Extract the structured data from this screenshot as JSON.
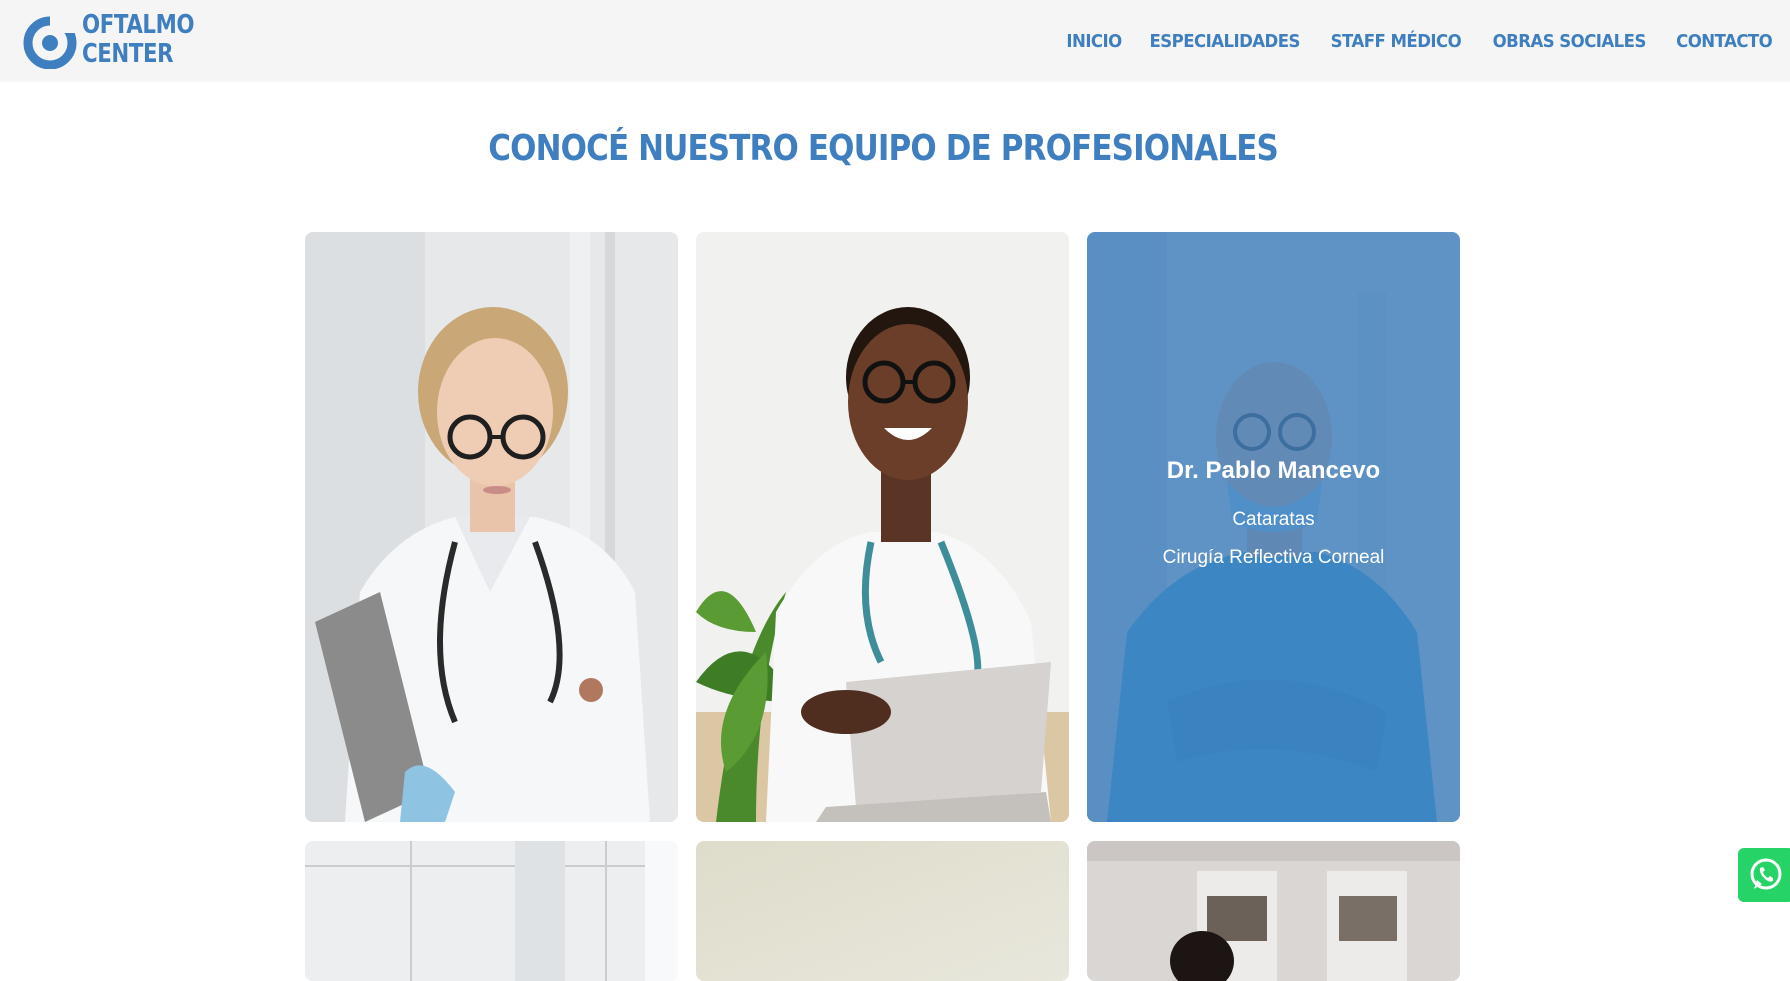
{
  "brand": {
    "line1": "OFTALMO",
    "line2": "CENTER",
    "color": "#3f7fbf"
  },
  "nav": {
    "items": [
      "INICIO",
      "ESPECIALIDADES",
      "STAFF MÉDICO",
      "OBRAS SOCIALES",
      "CONTACTO"
    ]
  },
  "main": {
    "title": "CONOCÉ NUESTRO EQUIPO DE PROFESIONALES",
    "hover_card": {
      "name": "Dr. Pablo Mancevo",
      "specialties": [
        "Cataratas",
        "Cirugía Reflectiva Corneal"
      ]
    }
  },
  "widgets": {
    "whatsapp_icon": "whatsapp-icon"
  }
}
